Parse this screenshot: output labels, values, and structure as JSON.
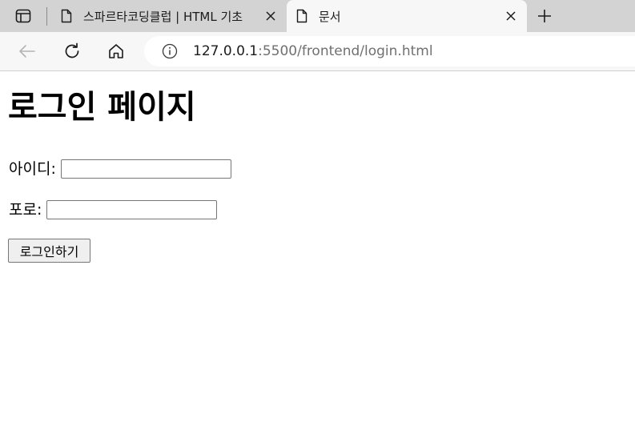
{
  "browser": {
    "tabs": [
      {
        "title": "스파르타코딩클럽 | HTML 기초",
        "active": false,
        "icon": "document-icon"
      },
      {
        "title": "문서",
        "active": true,
        "icon": "document-icon"
      }
    ],
    "address": {
      "host": "127.0.0.1",
      "rest": ":5500/frontend/login.html"
    },
    "colors": {
      "tabstrip": "#d3d3d3",
      "toolbar": "#f7f7f7",
      "url_dim": "#707070"
    }
  },
  "page": {
    "heading": "로그인 페이지",
    "id_label": "아이디:",
    "id_value": "",
    "pw_label": "포로:",
    "pw_value": "",
    "login_button": "로그인하기"
  }
}
